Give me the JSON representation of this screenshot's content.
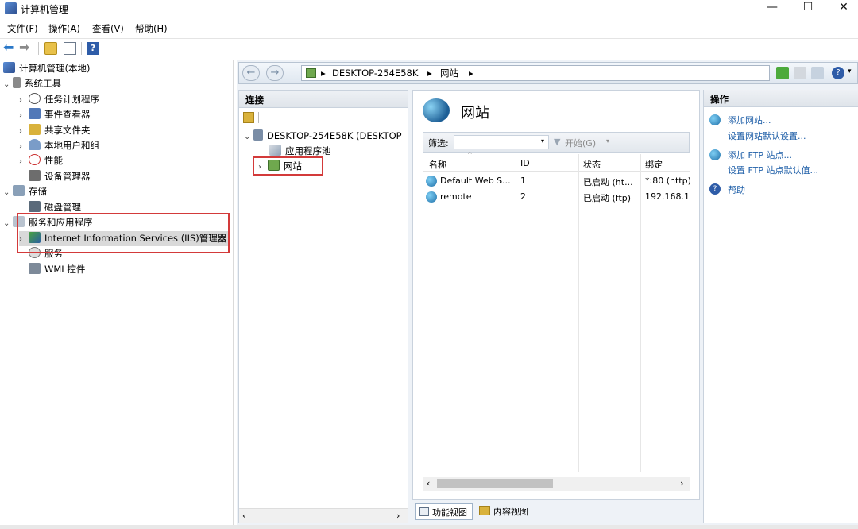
{
  "window": {
    "title": "计算机管理",
    "minimize": "—",
    "maximize": "☐",
    "close": "✕"
  },
  "menu": [
    "文件(F)",
    "操作(A)",
    "查看(V)",
    "帮助(H)"
  ],
  "tree": {
    "root": "计算机管理(本地)",
    "system_tools": "系统工具",
    "task_scheduler": "任务计划程序",
    "event_viewer": "事件查看器",
    "shared_folders": "共享文件夹",
    "local_users": "本地用户和组",
    "performance": "性能",
    "device_manager": "设备管理器",
    "storage": "存储",
    "disk_management": "磁盘管理",
    "services_apps": "服务和应用程序",
    "iis": "Internet Information Services (IIS)管理器",
    "services": "服务",
    "wmi": "WMI 控件"
  },
  "address": {
    "host": "DESKTOP-254E58K",
    "sep1": "▸",
    "sites": "网站",
    "sep2": "▸"
  },
  "connections": {
    "header": "连接",
    "server": "DESKTOP-254E58K (DESKTOP",
    "app_pools": "应用程序池",
    "sites": "网站"
  },
  "center": {
    "title": "网站",
    "filter_label": "筛选:",
    "go_label": "开始(G)",
    "columns": [
      "名称",
      "ID",
      "状态",
      "绑定"
    ],
    "rows": [
      {
        "name": "Default Web S...",
        "id": "1",
        "status": "已启动 (ht...",
        "binding": "*:80 (http)"
      },
      {
        "name": "remote",
        "id": "2",
        "status": "已启动 (ftp)",
        "binding": "192.168.1."
      }
    ]
  },
  "view_tabs": {
    "features": "功能视图",
    "content": "内容视图"
  },
  "actions": {
    "header": "操作",
    "add_site": "添加网站...",
    "site_defaults": "设置网站默认设置...",
    "add_ftp": "添加 FTP 站点...",
    "ftp_defaults": "设置 FTP 站点默认值...",
    "help": "帮助"
  },
  "colors": {
    "link": "#1f5fa8",
    "highlight_border": "#d33a3a"
  }
}
